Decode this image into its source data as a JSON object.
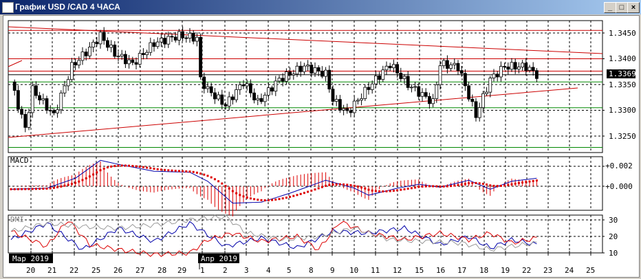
{
  "window": {
    "title": "График USD /CAD  4 ЧАСА",
    "min": "_",
    "max": "□",
    "close": "×"
  },
  "price_axis": {
    "labels": [
      "1.3450",
      "1.3400",
      "1.3350",
      "1.3300",
      "1.3250"
    ],
    "current": "1.3369"
  },
  "macd": {
    "label": "MACD",
    "labels": [
      "+0.002",
      "+0.000"
    ]
  },
  "dmi": {
    "label": "DMI",
    "labels": [
      "30",
      "20",
      "10"
    ]
  },
  "time_axis": {
    "months": [
      "Мар 2019",
      "Апр 2019"
    ],
    "days": [
      "20",
      "21",
      "22",
      "25",
      "26",
      "27",
      "28",
      "29",
      "1",
      "2",
      "3",
      "4",
      "5",
      "8",
      "9",
      "10",
      "11",
      "12",
      "15",
      "16",
      "17",
      "18",
      "19",
      "22",
      "23",
      "24",
      "25"
    ]
  },
  "chart_data": {
    "type": "candlestick",
    "symbol": "USD/CAD",
    "timeframe": "4H",
    "ylim": [
      1.3215,
      1.3475
    ],
    "close_keypoints": [
      [
        0,
        1.3355
      ],
      [
        4,
        1.3265
      ],
      [
        6,
        1.334
      ],
      [
        12,
        1.329
      ],
      [
        17,
        1.3385
      ],
      [
        22,
        1.342
      ],
      [
        25,
        1.3445
      ],
      [
        29,
        1.341
      ],
      [
        34,
        1.339
      ],
      [
        40,
        1.343
      ],
      [
        47,
        1.3445
      ],
      [
        52,
        1.344
      ],
      [
        53,
        1.336
      ],
      [
        55,
        1.334
      ],
      [
        60,
        1.331
      ],
      [
        65,
        1.3355
      ],
      [
        69,
        1.3315
      ],
      [
        75,
        1.336
      ],
      [
        82,
        1.3385
      ],
      [
        88,
        1.337
      ],
      [
        90,
        1.332
      ],
      [
        94,
        1.3295
      ],
      [
        100,
        1.3345
      ],
      [
        106,
        1.339
      ],
      [
        111,
        1.335
      ],
      [
        118,
        1.3315
      ],
      [
        120,
        1.339
      ],
      [
        125,
        1.3385
      ],
      [
        130,
        1.329
      ],
      [
        134,
        1.336
      ],
      [
        138,
        1.3385
      ],
      [
        144,
        1.3385
      ],
      [
        147,
        1.3369
      ]
    ],
    "levels_red": [
      1.3455,
      1.34,
      1.3376
    ],
    "levels_green": [
      1.3355,
      1.3305,
      1.3228
    ],
    "current": 1.3369,
    "macd_keypoints": [
      [
        0,
        -0.0003
      ],
      [
        10,
        -0.0002
      ],
      [
        18,
        0.0008
      ],
      [
        25,
        0.0026
      ],
      [
        30,
        0.0022
      ],
      [
        40,
        0.0015
      ],
      [
        50,
        0.0014
      ],
      [
        55,
        0.0005
      ],
      [
        62,
        -0.0017
      ],
      [
        70,
        -0.0016
      ],
      [
        78,
        -0.0007
      ],
      [
        88,
        0.0006
      ],
      [
        96,
        -0.0002
      ],
      [
        100,
        -0.0009
      ],
      [
        108,
        -0.0002
      ],
      [
        114,
        0.0002
      ],
      [
        120,
        -0.0001
      ],
      [
        128,
        0.0006
      ],
      [
        134,
        -0.0003
      ],
      [
        140,
        0.0005
      ],
      [
        147,
        0.0008
      ]
    ],
    "dmi_plus": [
      [
        0,
        18
      ],
      [
        10,
        28
      ],
      [
        20,
        12
      ],
      [
        30,
        25
      ],
      [
        40,
        17
      ],
      [
        50,
        28
      ],
      [
        60,
        14
      ],
      [
        70,
        19
      ],
      [
        80,
        13
      ],
      [
        90,
        23
      ],
      [
        100,
        22
      ],
      [
        110,
        25
      ],
      [
        120,
        15
      ],
      [
        128,
        20
      ],
      [
        134,
        13
      ],
      [
        140,
        18
      ],
      [
        147,
        15
      ]
    ],
    "dmi_minus": [
      [
        0,
        23
      ],
      [
        10,
        14
      ],
      [
        16,
        30
      ],
      [
        22,
        15
      ],
      [
        30,
        12
      ],
      [
        40,
        9
      ],
      [
        50,
        10
      ],
      [
        55,
        18
      ],
      [
        62,
        22
      ],
      [
        70,
        17
      ],
      [
        80,
        20
      ],
      [
        86,
        12
      ],
      [
        92,
        29
      ],
      [
        100,
        22
      ],
      [
        110,
        18
      ],
      [
        120,
        22
      ],
      [
        128,
        18
      ],
      [
        134,
        22
      ],
      [
        140,
        16
      ],
      [
        147,
        19
      ]
    ],
    "adx": [
      [
        0,
        23
      ],
      [
        10,
        28
      ],
      [
        20,
        26
      ],
      [
        30,
        25
      ],
      [
        40,
        27
      ],
      [
        50,
        30
      ],
      [
        60,
        32
      ],
      [
        66,
        22
      ],
      [
        76,
        18
      ],
      [
        86,
        20
      ],
      [
        96,
        25
      ],
      [
        106,
        18
      ],
      [
        116,
        17
      ],
      [
        126,
        16
      ],
      [
        134,
        12
      ],
      [
        140,
        14
      ],
      [
        147,
        16
      ]
    ]
  }
}
